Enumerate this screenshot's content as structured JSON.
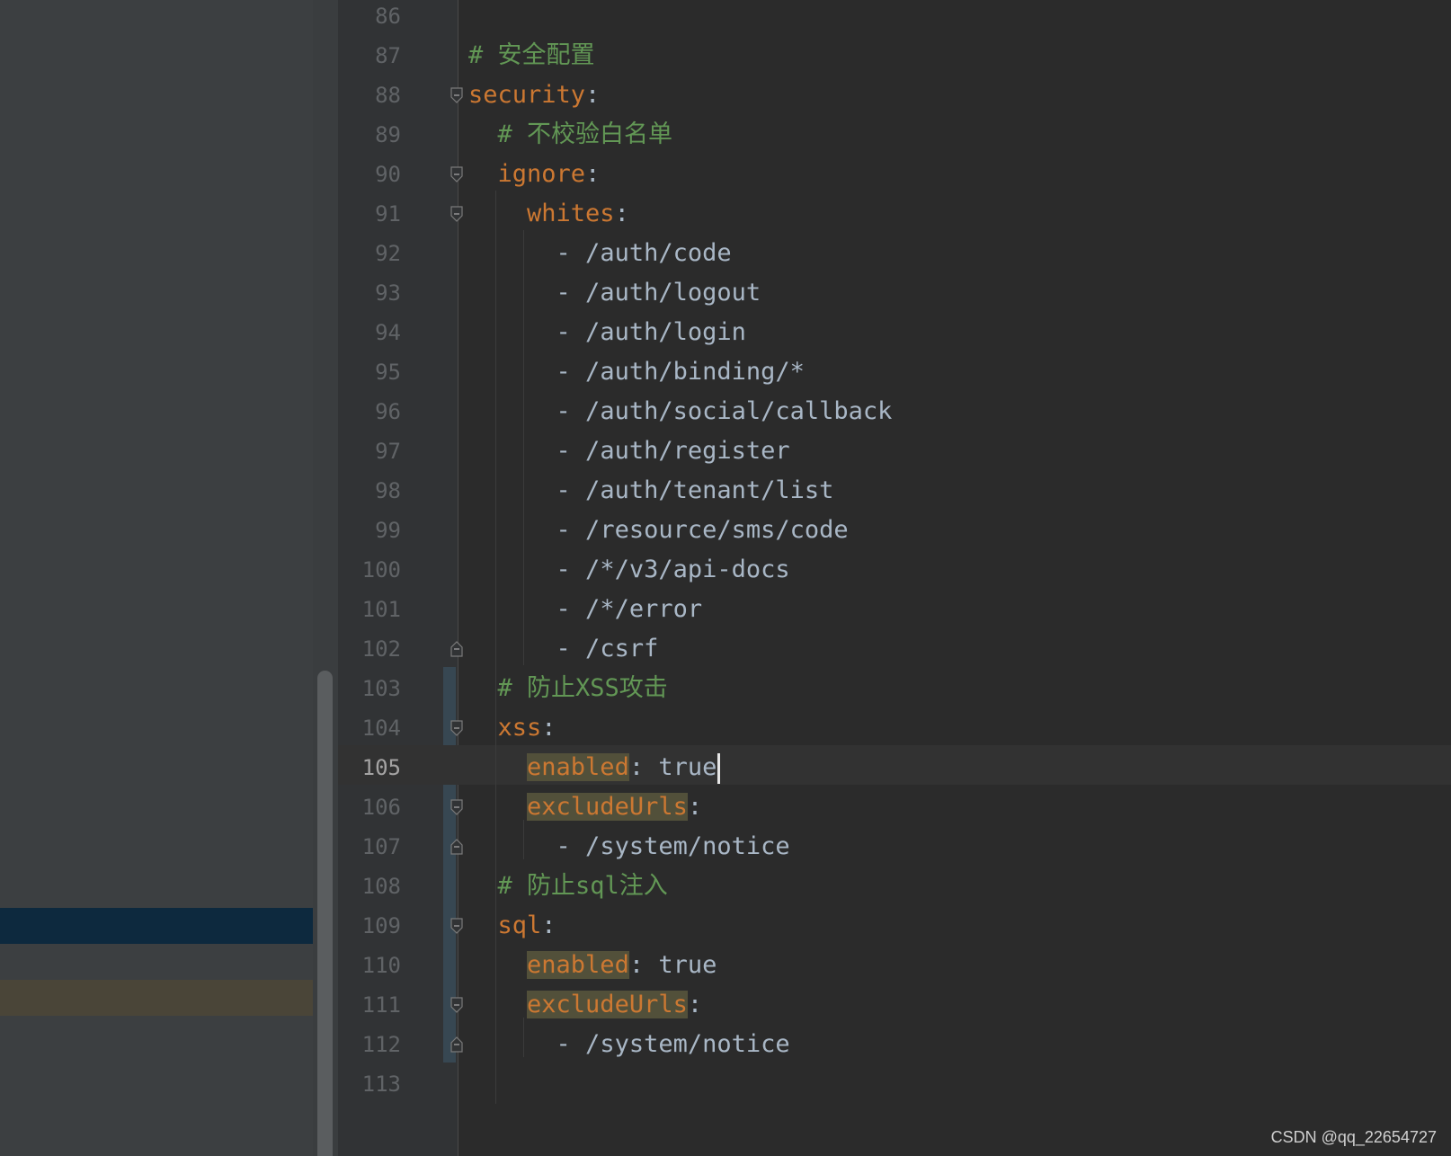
{
  "editor": {
    "language": "yaml",
    "current_line": "105",
    "lines": [
      {
        "num": "86",
        "indent": "",
        "comment": "",
        "key": "",
        "sep": "",
        "value": "",
        "marked": false
      },
      {
        "num": "87",
        "indent": "",
        "comment": "# 安全配置",
        "key": "",
        "sep": "",
        "value": "",
        "marked": false
      },
      {
        "num": "88",
        "indent": "",
        "comment": "",
        "key": "security",
        "sep": ":",
        "value": "",
        "marked": false
      },
      {
        "num": "89",
        "indent": "  ",
        "comment": "# 不校验白名单",
        "key": "",
        "sep": "",
        "value": "",
        "marked": false
      },
      {
        "num": "90",
        "indent": "  ",
        "comment": "",
        "key": "ignore",
        "sep": ":",
        "value": "",
        "marked": false
      },
      {
        "num": "91",
        "indent": "    ",
        "comment": "",
        "key": "whites",
        "sep": ":",
        "value": "",
        "marked": false
      },
      {
        "num": "92",
        "indent": "      ",
        "comment": "",
        "key": "",
        "sep": "",
        "value": "- /auth/code",
        "marked": false
      },
      {
        "num": "93",
        "indent": "      ",
        "comment": "",
        "key": "",
        "sep": "",
        "value": "- /auth/logout",
        "marked": false
      },
      {
        "num": "94",
        "indent": "      ",
        "comment": "",
        "key": "",
        "sep": "",
        "value": "- /auth/login",
        "marked": false
      },
      {
        "num": "95",
        "indent": "      ",
        "comment": "",
        "key": "",
        "sep": "",
        "value": "- /auth/binding/*",
        "marked": false
      },
      {
        "num": "96",
        "indent": "      ",
        "comment": "",
        "key": "",
        "sep": "",
        "value": "- /auth/social/callback",
        "marked": false
      },
      {
        "num": "97",
        "indent": "      ",
        "comment": "",
        "key": "",
        "sep": "",
        "value": "- /auth/register",
        "marked": false
      },
      {
        "num": "98",
        "indent": "      ",
        "comment": "",
        "key": "",
        "sep": "",
        "value": "- /auth/tenant/list",
        "marked": false
      },
      {
        "num": "99",
        "indent": "      ",
        "comment": "",
        "key": "",
        "sep": "",
        "value": "- /resource/sms/code",
        "marked": false
      },
      {
        "num": "100",
        "indent": "      ",
        "comment": "",
        "key": "",
        "sep": "",
        "value": "- /*/v3/api-docs",
        "marked": false
      },
      {
        "num": "101",
        "indent": "      ",
        "comment": "",
        "key": "",
        "sep": "",
        "value": "- /*/error",
        "marked": false
      },
      {
        "num": "102",
        "indent": "      ",
        "comment": "",
        "key": "",
        "sep": "",
        "value": "- /csrf",
        "marked": false
      },
      {
        "num": "103",
        "indent": "  ",
        "comment": "# 防止XSS攻击",
        "key": "",
        "sep": "",
        "value": "",
        "marked": false
      },
      {
        "num": "104",
        "indent": "  ",
        "comment": "",
        "key": "xss",
        "sep": ":",
        "value": "",
        "marked": false
      },
      {
        "num": "105",
        "indent": "    ",
        "comment": "",
        "key": "enabled",
        "sep": ": ",
        "value": "true",
        "marked": true
      },
      {
        "num": "106",
        "indent": "    ",
        "comment": "",
        "key": "excludeUrls",
        "sep": ":",
        "value": "",
        "marked": true
      },
      {
        "num": "107",
        "indent": "      ",
        "comment": "",
        "key": "",
        "sep": "",
        "value": "- /system/notice",
        "marked": false
      },
      {
        "num": "108",
        "indent": "  ",
        "comment": "# 防止sql注入",
        "key": "",
        "sep": "",
        "value": "",
        "marked": false
      },
      {
        "num": "109",
        "indent": "  ",
        "comment": "",
        "key": "sql",
        "sep": ":",
        "value": "",
        "marked": false
      },
      {
        "num": "110",
        "indent": "    ",
        "comment": "",
        "key": "enabled",
        "sep": ": ",
        "value": "true",
        "marked": true
      },
      {
        "num": "111",
        "indent": "    ",
        "comment": "",
        "key": "excludeUrls",
        "sep": ":",
        "value": "",
        "marked": true
      },
      {
        "num": "112",
        "indent": "      ",
        "comment": "",
        "key": "",
        "sep": "",
        "value": "- /system/notice",
        "marked": false
      },
      {
        "num": "113",
        "indent": "",
        "comment": "",
        "key": "",
        "sep": "",
        "value": "",
        "marked": false
      }
    ]
  },
  "watermark": "CSDN @qq_22654727",
  "colors": {
    "background": "#2b2b2b",
    "keyword": "#cc7832",
    "comment": "#629755",
    "text": "#a9b7c6",
    "line_number": "#606366"
  }
}
